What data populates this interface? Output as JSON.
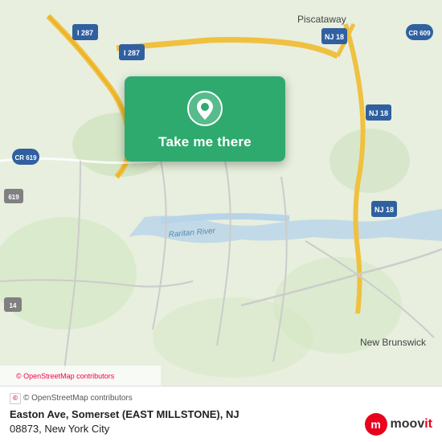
{
  "map": {
    "background_color": "#e8efde",
    "center_lat": 40.52,
    "center_lon": -74.53
  },
  "card": {
    "background_color": "#2eaa6e",
    "button_label": "Take me there"
  },
  "bottom_bar": {
    "osm_credit": "© OpenStreetMap contributors",
    "address": "Easton Ave, Somerset (EAST MILLSTONE), NJ 08873, New York City"
  },
  "moovit": {
    "logo_text": "moovit",
    "icon": "m"
  },
  "route_labels": [
    {
      "id": "I-287-1",
      "text": "I 287"
    },
    {
      "id": "I-287-2",
      "text": "I 287"
    },
    {
      "id": "NJ-18-1",
      "text": "NJ 18"
    },
    {
      "id": "NJ-18-2",
      "text": "NJ 18"
    },
    {
      "id": "NJ-18-3",
      "text": "NJ 18"
    },
    {
      "id": "CR-609",
      "text": "CR 609"
    },
    {
      "id": "CR-619",
      "text": "CR 619"
    },
    {
      "id": "619",
      "text": "619"
    },
    {
      "id": "14",
      "text": "14"
    },
    {
      "id": "Piscataway",
      "text": "Piscataway"
    },
    {
      "id": "New Brunswick",
      "text": "New Brunswick"
    },
    {
      "id": "Raritan River",
      "text": "Raritan River"
    }
  ]
}
